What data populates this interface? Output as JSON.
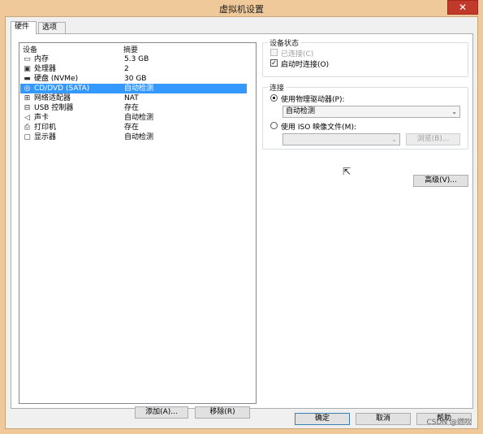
{
  "window": {
    "title": "虚拟机设置",
    "close_label": "✕"
  },
  "tabs": [
    {
      "label": "硬件",
      "active": true
    },
    {
      "label": "选项",
      "active": false
    }
  ],
  "device_list": {
    "columns": {
      "device": "设备",
      "summary": "摘要"
    },
    "rows": [
      {
        "icon": "memory-icon",
        "glyph": "▭",
        "name": "内存",
        "summary": "5.3 GB",
        "selected": false
      },
      {
        "icon": "processor-icon",
        "glyph": "▣",
        "name": "处理器",
        "summary": "2",
        "selected": false
      },
      {
        "icon": "hard-disk-icon",
        "glyph": "▬",
        "name": "硬盘 (NVMe)",
        "summary": "30 GB",
        "selected": false
      },
      {
        "icon": "cd-dvd-icon",
        "glyph": "◎",
        "name": "CD/DVD (SATA)",
        "summary": "自动检测",
        "selected": true
      },
      {
        "icon": "network-adapter-icon",
        "glyph": "⊞",
        "name": "网络适配器",
        "summary": "NAT",
        "selected": false
      },
      {
        "icon": "usb-controller-icon",
        "glyph": "⊟",
        "name": "USB 控制器",
        "summary": "存在",
        "selected": false
      },
      {
        "icon": "sound-card-icon",
        "glyph": "◁",
        "name": "声卡",
        "summary": "自动检测",
        "selected": false
      },
      {
        "icon": "printer-icon",
        "glyph": "⎙",
        "name": "打印机",
        "summary": "存在",
        "selected": false
      },
      {
        "icon": "display-icon",
        "glyph": "▢",
        "name": "显示器",
        "summary": "自动检测",
        "selected": false
      }
    ],
    "add_button": "添加(A)...",
    "remove_button": "移除(R)"
  },
  "device_status": {
    "title": "设备状态",
    "connected": {
      "label": "已连接(C)",
      "checked": false,
      "enabled": false
    },
    "connect_at_power_on": {
      "label": "启动时连接(O)",
      "checked": true,
      "enabled": true
    }
  },
  "connection": {
    "title": "连接",
    "use_physical_drive": {
      "label": "使用物理驱动器(P):",
      "selected": true
    },
    "physical_drive_value": "自动检测",
    "use_iso": {
      "label": "使用 ISO 映像文件(M):",
      "selected": false
    },
    "iso_value": "",
    "browse_button": "浏览(B)..."
  },
  "advanced_button": "高级(V)...",
  "footer": {
    "ok": "确定",
    "cancel": "取消",
    "help": "帮助"
  },
  "watermark": "CSDN @燃吹"
}
